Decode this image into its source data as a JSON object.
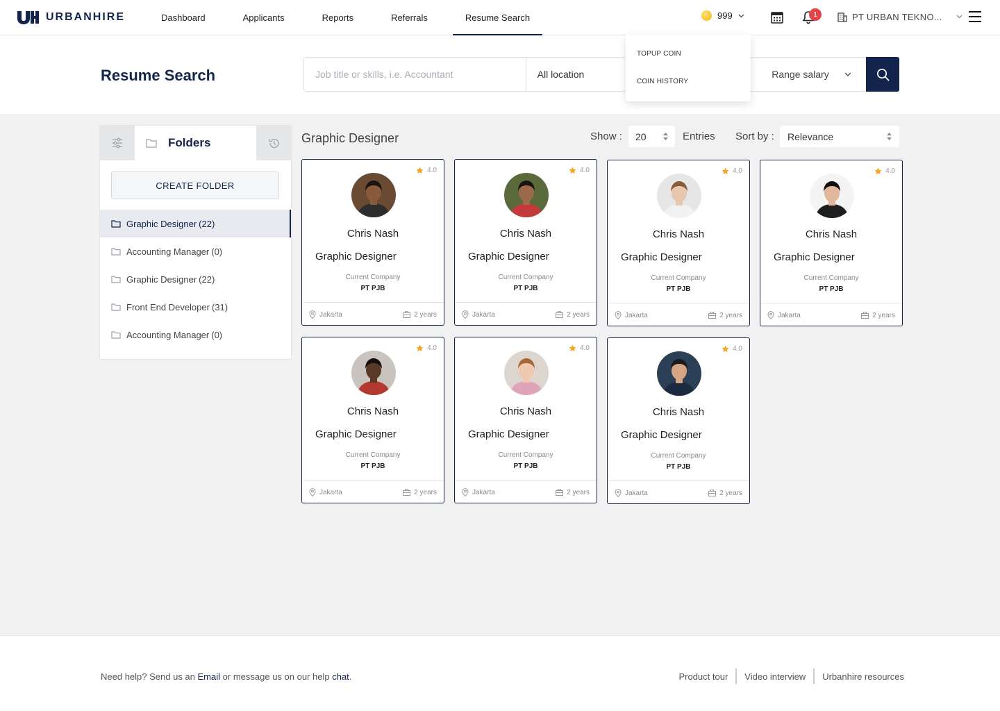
{
  "header": {
    "brand": "URBANHIRE",
    "nav": [
      {
        "label": "Dashboard"
      },
      {
        "label": "Applicants"
      },
      {
        "label": "Reports"
      },
      {
        "label": "Referrals"
      },
      {
        "label": "Resume Search",
        "active": true
      }
    ],
    "coins": "999",
    "notifications": "1",
    "company": "PT URBAN TEKNO..."
  },
  "coin_menu": {
    "items": [
      "TOPUP COIN",
      "COIN HISTORY"
    ]
  },
  "search": {
    "title": "Resume Search",
    "keyword_placeholder": "Job title or skills, i.e. Accountant",
    "location": "All location",
    "salary": "Range salary"
  },
  "folders": {
    "tab_label": "Folders",
    "create_label": "CREATE FOLDER",
    "items": [
      {
        "label": "Graphic Designer",
        "count": "(22)",
        "active": true
      },
      {
        "label": "Accounting Manager",
        "count": "(0)"
      },
      {
        "label": "Graphic Designer",
        "count": "(22)"
      },
      {
        "label": "Front End Developer",
        "count": "(31)"
      },
      {
        "label": "Accounting Manager",
        "count": "(0)"
      }
    ]
  },
  "results": {
    "title": "Graphic Designer",
    "show_label": "Show :",
    "show_value": "20",
    "entries_label": "Entries",
    "sort_label": "Sort by :",
    "sort_value": "Relevance",
    "company_label": "Current Company",
    "cards": [
      {
        "name": "Chris Nash",
        "role": "Graphic Designer",
        "company": "PT PJB",
        "location": "Jakarta",
        "experience": "2 years",
        "rating": "4.0",
        "skin": "#8a5a3c",
        "hair": "#1a1410",
        "shirt": "#2d2d2d",
        "bg": "#6b4a34"
      },
      {
        "name": "Chris Nash",
        "role": "Graphic Designer",
        "company": "PT PJB",
        "location": "Jakarta",
        "experience": "2 years",
        "rating": "4.0",
        "skin": "#9c6a4a",
        "hair": "#181210",
        "shirt": "#c23a3a",
        "bg": "#5a6a3a"
      },
      {
        "name": "Chris Nash",
        "role": "Graphic Designer",
        "company": "PT PJB",
        "location": "Jakarta",
        "experience": "2 years",
        "rating": "4.0",
        "skin": "#e8c6b0",
        "hair": "#8a5a3a",
        "shirt": "#f2f2f2",
        "bg": "#e6e6e6"
      },
      {
        "name": "Chris Nash",
        "role": "Graphic Designer",
        "company": "PT PJB",
        "location": "Jakarta",
        "experience": "2 years",
        "rating": "4.0",
        "skin": "#e2b89c",
        "hair": "#111111",
        "shirt": "#1e1e1e",
        "bg": "#f4f4f4"
      },
      {
        "name": "Chris Nash",
        "role": "Graphic Designer",
        "company": "PT PJB",
        "location": "Jakarta",
        "experience": "2 years",
        "rating": "4.0",
        "skin": "#5a3826",
        "hair": "#151010",
        "shirt": "#b23a2e",
        "bg": "#c9c4be"
      },
      {
        "name": "Chris Nash",
        "role": "Graphic Designer",
        "company": "PT PJB",
        "location": "Jakarta",
        "experience": "2 years",
        "rating": "4.0",
        "skin": "#efc9b0",
        "hair": "#a8693a",
        "shirt": "#e0a4b8",
        "bg": "#ddd6d0"
      },
      {
        "name": "Chris Nash",
        "role": "Graphic Designer",
        "company": "PT PJB",
        "location": "Jakarta",
        "experience": "2 years",
        "rating": "4.0",
        "skin": "#d6a584",
        "hair": "#1a1a1a",
        "shirt": "#1c2b40",
        "bg": "#2b3f56"
      }
    ]
  },
  "footer": {
    "help_prefix": "Need help? Send us an",
    "help_email": "Email",
    "help_middle": "or message us on our help",
    "help_chat": "chat",
    "help_suffix": ".",
    "links": [
      "Product tour",
      "Video interview",
      "Urbanhire resources"
    ]
  },
  "colors": {
    "brand": "#13244d",
    "star": "#f5a623",
    "badge": "#e0454a",
    "coin": "#f4b400"
  }
}
